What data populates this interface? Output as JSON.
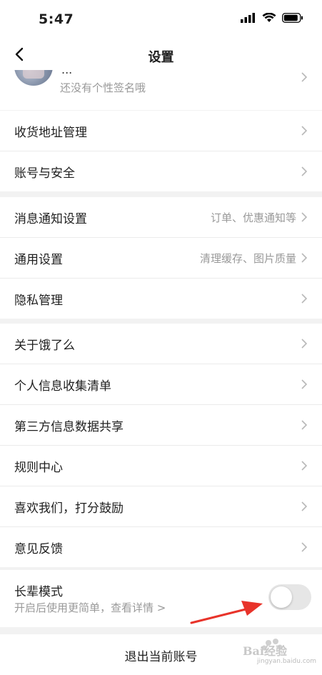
{
  "status": {
    "time": "5:47"
  },
  "nav": {
    "title": "设置"
  },
  "profile": {
    "nickname_fragment": "...",
    "signature": "还没有个性签名哦"
  },
  "groups": [
    {
      "items": [
        {
          "label": "收货地址管理",
          "hint": ""
        },
        {
          "label": "账号与安全",
          "hint": ""
        }
      ]
    },
    {
      "items": [
        {
          "label": "消息通知设置",
          "hint": "订单、优惠通知等"
        },
        {
          "label": "通用设置",
          "hint": "清理缓存、图片质量"
        },
        {
          "label": "隐私管理",
          "hint": ""
        }
      ]
    },
    {
      "items": [
        {
          "label": "关于饿了么",
          "hint": ""
        },
        {
          "label": "个人信息收集清单",
          "hint": ""
        },
        {
          "label": "第三方信息数据共享",
          "hint": ""
        },
        {
          "label": "规则中心",
          "hint": ""
        },
        {
          "label": "喜欢我们，打分鼓励",
          "hint": ""
        },
        {
          "label": "意见反馈",
          "hint": ""
        }
      ]
    }
  ],
  "elder_mode": {
    "title": "长辈模式",
    "subtitle": "开启后使用更简单，查看详情 >",
    "enabled": false
  },
  "logout": {
    "label": "退出当前账号"
  },
  "watermark": {
    "text": "Bai经验",
    "sub": "jingyan.baidu.com"
  },
  "colors": {
    "arrow": "#e8332a",
    "muted": "#999999",
    "toggle_off": "#e6e6e6"
  }
}
